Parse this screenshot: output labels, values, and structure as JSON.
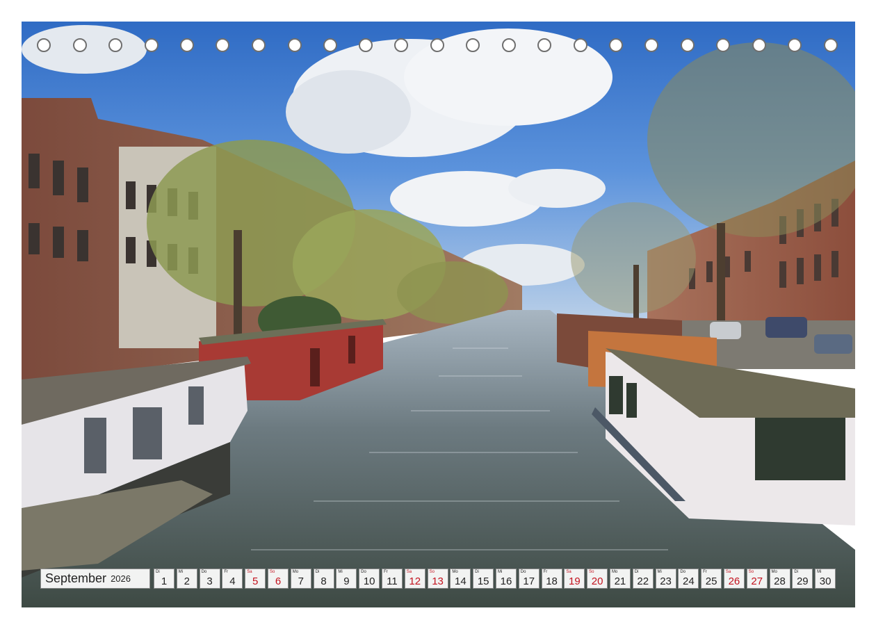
{
  "calendar": {
    "month": "September",
    "year": "2026",
    "weekend_color": "#c3121e",
    "days": [
      {
        "wd": "Di",
        "num": "1",
        "weekend": false
      },
      {
        "wd": "Mi",
        "num": "2",
        "weekend": false
      },
      {
        "wd": "Do",
        "num": "3",
        "weekend": false
      },
      {
        "wd": "Fr",
        "num": "4",
        "weekend": false
      },
      {
        "wd": "Sa",
        "num": "5",
        "weekend": true
      },
      {
        "wd": "So",
        "num": "6",
        "weekend": true
      },
      {
        "wd": "Mo",
        "num": "7",
        "weekend": false
      },
      {
        "wd": "Di",
        "num": "8",
        "weekend": false
      },
      {
        "wd": "Mi",
        "num": "9",
        "weekend": false
      },
      {
        "wd": "Do",
        "num": "10",
        "weekend": false
      },
      {
        "wd": "Fr",
        "num": "11",
        "weekend": false
      },
      {
        "wd": "Sa",
        "num": "12",
        "weekend": true
      },
      {
        "wd": "So",
        "num": "13",
        "weekend": true
      },
      {
        "wd": "Mo",
        "num": "14",
        "weekend": false
      },
      {
        "wd": "Di",
        "num": "15",
        "weekend": false
      },
      {
        "wd": "Mi",
        "num": "16",
        "weekend": false
      },
      {
        "wd": "Do",
        "num": "17",
        "weekend": false
      },
      {
        "wd": "Fr",
        "num": "18",
        "weekend": false
      },
      {
        "wd": "Sa",
        "num": "19",
        "weekend": true
      },
      {
        "wd": "So",
        "num": "20",
        "weekend": true
      },
      {
        "wd": "Mo",
        "num": "21",
        "weekend": false
      },
      {
        "wd": "Di",
        "num": "22",
        "weekend": false
      },
      {
        "wd": "Mi",
        "num": "23",
        "weekend": false
      },
      {
        "wd": "Do",
        "num": "24",
        "weekend": false
      },
      {
        "wd": "Fr",
        "num": "25",
        "weekend": false
      },
      {
        "wd": "Sa",
        "num": "26",
        "weekend": true
      },
      {
        "wd": "So",
        "num": "27",
        "weekend": true
      },
      {
        "wd": "Mo",
        "num": "28",
        "weekend": false
      },
      {
        "wd": "Di",
        "num": "29",
        "weekend": false
      },
      {
        "wd": "Mi",
        "num": "30",
        "weekend": false
      }
    ]
  }
}
